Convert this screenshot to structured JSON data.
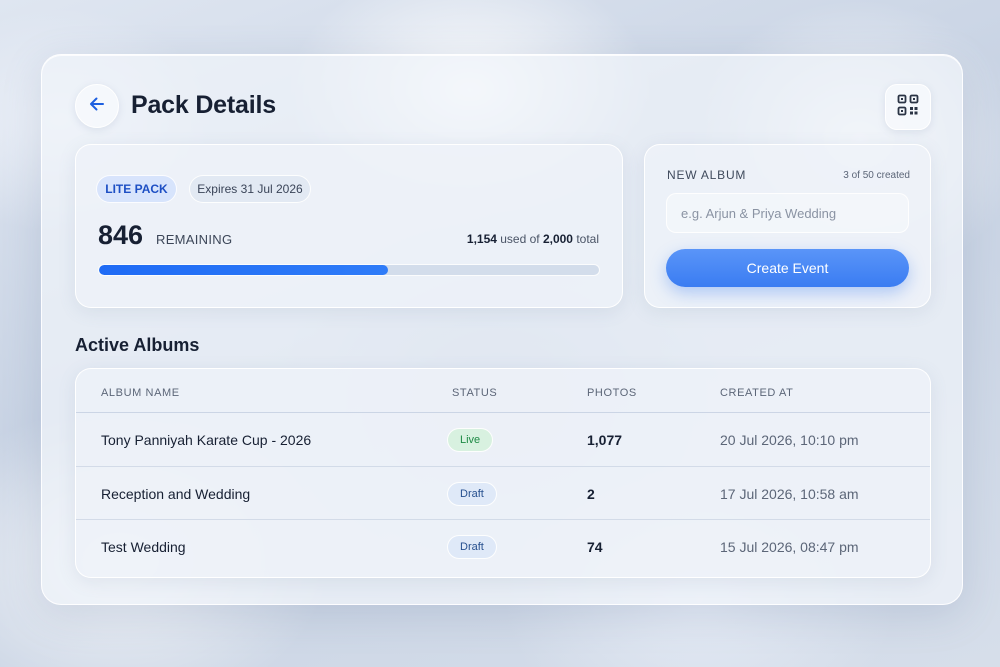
{
  "header": {
    "title": "Pack Details"
  },
  "pack": {
    "name": "LITE PACK",
    "expires": "Expires 31 Jul 2026",
    "remaining": "846",
    "remaining_label": "REMAINING",
    "used": "1,154",
    "used_of_text": " used of ",
    "total": "2,000",
    "total_suffix": " total",
    "progress_fraction": 0.577
  },
  "new_album": {
    "label": "NEW ALBUM",
    "count": "3 of 50 created",
    "placeholder": "e.g. Arjun & Priya Wedding",
    "button": "Create Event"
  },
  "albums": {
    "title": "Active Albums",
    "columns": [
      "ALBUM NAME",
      "STATUS",
      "PHOTOS",
      "CREATED AT"
    ],
    "rows": [
      {
        "name": "Tony Panniyah Karate Cup - 2026",
        "status": "Live",
        "photos": "1,077",
        "created": "20 Jul 2026, 10:10 pm"
      },
      {
        "name": "Reception and Wedding",
        "status": "Draft",
        "photos": "2",
        "created": "17 Jul 2026, 10:58 am"
      },
      {
        "name": "Test Wedding",
        "status": "Draft",
        "photos": "74",
        "created": "15 Jul 2026, 08:47 pm"
      }
    ]
  },
  "icons": {
    "back": "arrow-left-icon",
    "qr": "qr-code-icon"
  },
  "colors": {
    "accent": "#2f7cf8",
    "live": "#1e8a45",
    "draft": "#27508f"
  }
}
